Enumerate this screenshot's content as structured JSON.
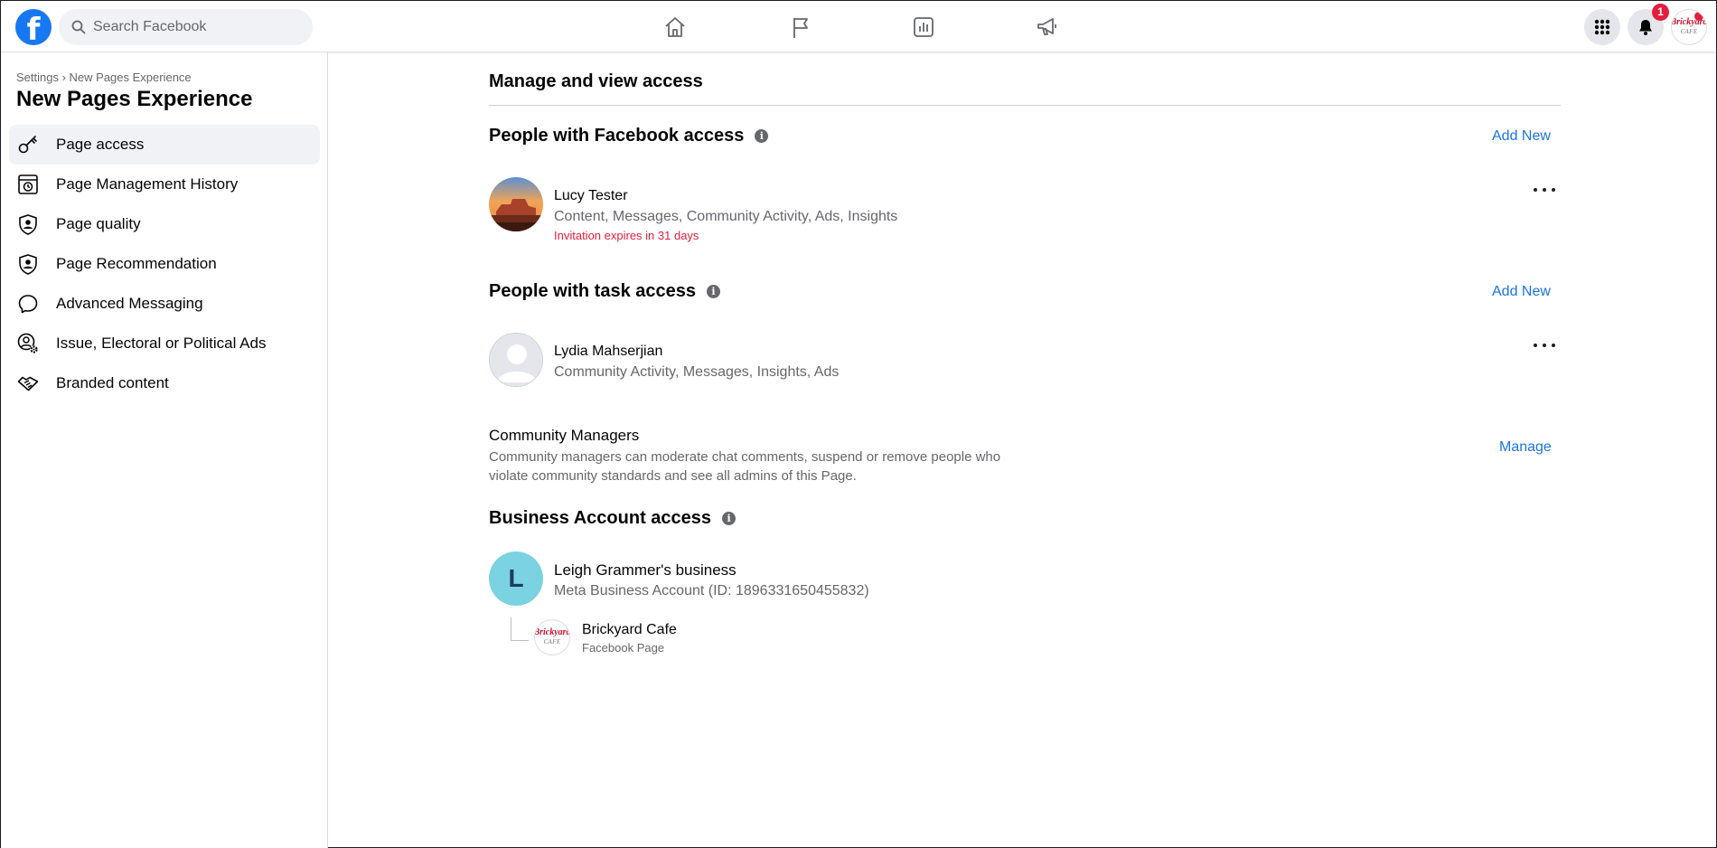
{
  "topbar": {
    "logo_letter": "f",
    "search_placeholder": "Search Facebook",
    "notifications_count": "1",
    "brand_avatar_text": "Brickyard",
    "brand_avatar_sub": "CAFE"
  },
  "sidebar": {
    "breadcrumb": "Settings › New Pages Experience",
    "title": "New Pages Experience",
    "items": [
      {
        "label": "Page access",
        "icon": "key-icon",
        "active": true
      },
      {
        "label": "Page Management History",
        "icon": "history-icon"
      },
      {
        "label": "Page quality",
        "icon": "shield-person-icon"
      },
      {
        "label": "Page Recommendation",
        "icon": "shield-person-icon"
      },
      {
        "label": "Advanced Messaging",
        "icon": "chat-bubble-icon"
      },
      {
        "label": "Issue, Electoral or Political Ads",
        "icon": "person-gear-icon"
      },
      {
        "label": "Branded content",
        "icon": "handshake-icon"
      }
    ]
  },
  "main": {
    "heading": "Manage and view access",
    "facebook_access": {
      "title": "People with Facebook access",
      "add_label": "Add New",
      "person": {
        "name": "Lucy Tester",
        "permissions": "Content, Messages, Community Activity, Ads, Insights",
        "warning": "Invitation expires in 31 days"
      }
    },
    "task_access": {
      "title": "People with task access",
      "add_label": "Add New",
      "person": {
        "name": "Lydia Mahserjian",
        "permissions": "Community Activity, Messages, Insights, Ads"
      }
    },
    "community_managers": {
      "title": "Community Managers",
      "description": "Community managers can moderate chat comments, suspend or remove people who violate community standards and see all admins of this Page.",
      "manage_label": "Manage"
    },
    "business_access": {
      "title": "Business Account access",
      "account": {
        "initial": "L",
        "name": "Leigh Grammer's business",
        "detail": "Meta Business Account (ID: 1896331650455832)"
      },
      "page": {
        "name": "Brickyard Cafe",
        "type": "Facebook Page"
      }
    }
  }
}
